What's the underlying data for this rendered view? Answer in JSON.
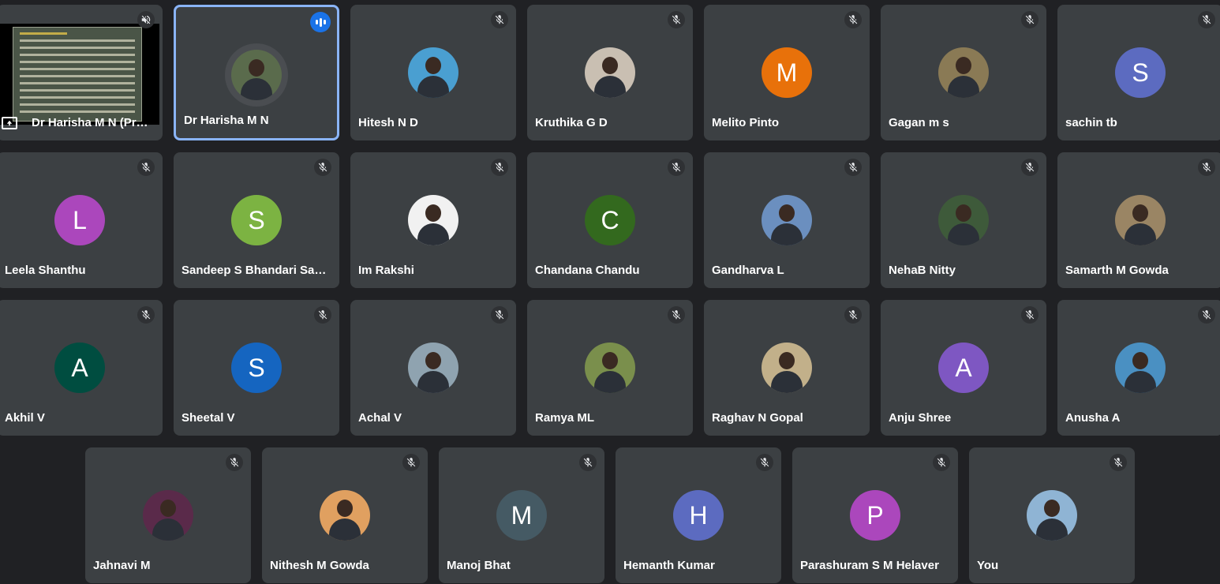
{
  "participants": [
    {
      "name": "Dr Harisha M N (Pre...",
      "type": "presentation",
      "icon": "volume-off-icon"
    },
    {
      "name": "Dr Harisha M N",
      "type": "photo",
      "speaking": true,
      "photo": "#5a6b4c"
    },
    {
      "name": "Hitesh N D",
      "type": "photo",
      "photo": "#4a9fd1"
    },
    {
      "name": "Kruthika G D",
      "type": "photo",
      "photo": "#c9bfb2"
    },
    {
      "name": "Melito Pinto",
      "type": "letter",
      "letter": "M",
      "color": "#e8710a"
    },
    {
      "name": "Gagan m s",
      "type": "photo",
      "photo": "#8a7a55"
    },
    {
      "name": "sachin tb",
      "type": "letter",
      "letter": "S",
      "color": "#5c6bc0"
    },
    {
      "name": "Leela Shanthu",
      "type": "letter",
      "letter": "L",
      "color": "#ab47bc"
    },
    {
      "name": "Sandeep S Bhandari Sand...",
      "type": "letter",
      "letter": "S",
      "color": "#7cb342"
    },
    {
      "name": "Im Rakshi",
      "type": "photo",
      "photo": "#f1f1f1"
    },
    {
      "name": "Chandana Chandu",
      "type": "letter",
      "letter": "C",
      "color": "#33691e"
    },
    {
      "name": "Gandharva L",
      "type": "photo",
      "photo": "#6b8fbf"
    },
    {
      "name": "NehaB Nitty",
      "type": "photo",
      "photo": "#3e5a3a"
    },
    {
      "name": "Samarth M Gowda",
      "type": "photo",
      "photo": "#9a8564"
    },
    {
      "name": "Akhil V",
      "type": "letter",
      "letter": "A",
      "color": "#004d40"
    },
    {
      "name": "Sheetal V",
      "type": "letter",
      "letter": "S",
      "color": "#1565c0"
    },
    {
      "name": "Achal V",
      "type": "photo",
      "photo": "#8fa3b0"
    },
    {
      "name": "Ramya ML",
      "type": "photo",
      "photo": "#7a8f4c"
    },
    {
      "name": "Raghav N Gopal",
      "type": "photo",
      "photo": "#c2b08a"
    },
    {
      "name": "Anju Shree",
      "type": "letter",
      "letter": "A",
      "color": "#7e57c2"
    },
    {
      "name": "Anusha A",
      "type": "photo",
      "photo": "#4a90c2"
    },
    {
      "name": "Jahnavi M",
      "type": "photo",
      "photo": "#5a2a4a"
    },
    {
      "name": "Nithesh M Gowda",
      "type": "photo",
      "photo": "#e0a060"
    },
    {
      "name": "Manoj Bhat",
      "type": "letter",
      "letter": "M",
      "color": "#455a64"
    },
    {
      "name": "Hemanth Kumar",
      "type": "letter",
      "letter": "H",
      "color": "#5c6bc0"
    },
    {
      "name": "Parashuram S M Helaver",
      "type": "letter",
      "letter": "P",
      "color": "#ab47bc"
    },
    {
      "name": "You",
      "type": "photo",
      "photo": "#8fb4d4"
    }
  ]
}
